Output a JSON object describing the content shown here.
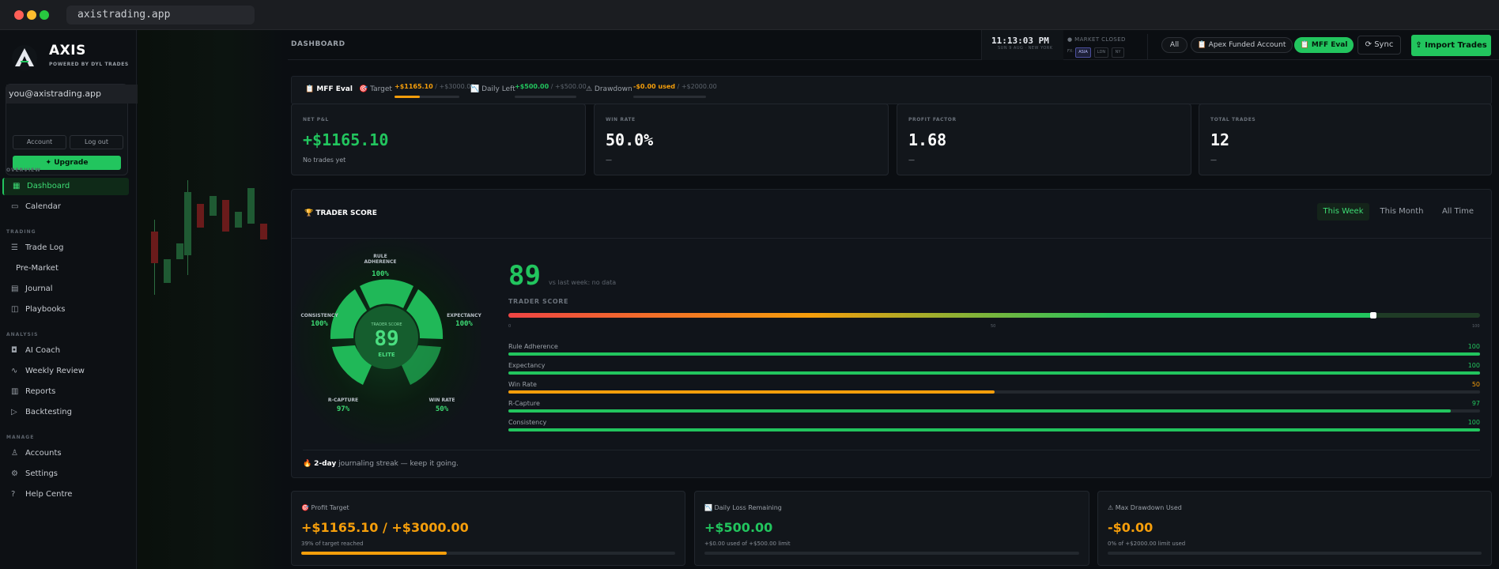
{
  "browser": {
    "url": "axistrading.app"
  },
  "brand": {
    "name": "AXIS",
    "subtitle": "POWERED BY DYL TRADES"
  },
  "account": {
    "email": "you@axistrading.app",
    "account_label": "Account",
    "logout_label": "Log out",
    "upgrade_label": "✦ Upgrade"
  },
  "sidebar": {
    "sections": [
      "OVERVIEW",
      "TRADING",
      "ANALYSIS",
      "MANAGE"
    ],
    "items": [
      {
        "label": "Dashboard"
      },
      {
        "label": "Calendar"
      },
      {
        "label": "Trade Log"
      },
      {
        "label": "Pre-Market"
      },
      {
        "label": "Journal"
      },
      {
        "label": "Playbooks"
      },
      {
        "label": "AI Coach"
      },
      {
        "label": "Weekly Review"
      },
      {
        "label": "Reports"
      },
      {
        "label": "Backtesting"
      },
      {
        "label": "Accounts"
      },
      {
        "label": "Settings"
      },
      {
        "label": "Help Centre"
      }
    ]
  },
  "topbar": {
    "title": "DASHBOARD",
    "clock": "11:13:03 PM",
    "clock_sub": "SUN 9 AUG · NEW YORK",
    "market_status": "● MARKET CLOSED",
    "sessions_label": "FX:",
    "sessions": [
      "ASIA",
      "LDN",
      "NY"
    ],
    "filter_all": "All",
    "account_apex": "📋 Apex Funded Account",
    "account_mff": "📋 MFF Eval",
    "sync_label": "⟳ Sync",
    "import_label": "⇪ Import Trades"
  },
  "evalbar": {
    "name": "📋 MFF Eval",
    "target_label": "🎯 Target",
    "target_value": "+$1165.10",
    "target_max": "/ +$3000.00",
    "target_progress": 0.39,
    "daily_label": "📉 Daily Left",
    "daily_value": "+$500.00",
    "daily_max": "/ +$500.00",
    "daily_progress": 0,
    "drawdown_label": "⚠ Drawdown",
    "drawdown_value": "-$0.00 used",
    "drawdown_max": "/ +$2000.00",
    "drawdown_progress": 0
  },
  "stats": [
    {
      "label": "NET P&L",
      "value": "+$1165.10",
      "sub": "No trades yet",
      "color": "#22c55e"
    },
    {
      "label": "WIN RATE",
      "value": "50.0%",
      "sub": "—",
      "color": "#ffffff"
    },
    {
      "label": "PROFIT FACTOR",
      "value": "1.68",
      "sub": "—",
      "color": "#ffffff"
    },
    {
      "label": "TOTAL TRADES",
      "value": "12",
      "sub": "—",
      "color": "#ffffff"
    }
  ],
  "score": {
    "title": "🏆 TRADER SCORE",
    "tabs": [
      "This Week",
      "This Month",
      "All Time"
    ],
    "value": "89",
    "vs_text": "vs last week: no data",
    "bar_label": "TRADER SCORE",
    "bar_value": 89,
    "ticks": [
      "0",
      "50",
      "100"
    ],
    "center_label": "TRADER SCORE",
    "center_tier": "ELITE",
    "radial": [
      {
        "name": "RULE ADHERENCE",
        "value": "100%"
      },
      {
        "name": "EXPECTANCY",
        "value": "100%"
      },
      {
        "name": "WIN RATE",
        "value": "50%"
      },
      {
        "name": "R-CAPTURE",
        "value": "97%"
      },
      {
        "name": "CONSISTENCY",
        "value": "100%"
      }
    ],
    "metrics": [
      {
        "name": "Rule Adherence",
        "value": 100,
        "label": "100",
        "color": "#22c55e"
      },
      {
        "name": "Expectancy",
        "value": 100,
        "label": "100",
        "color": "#22c55e"
      },
      {
        "name": "Win Rate",
        "value": 50,
        "label": "50",
        "color": "#f59e0b"
      },
      {
        "name": "R-Capture",
        "value": 97,
        "label": "97",
        "color": "#22c55e"
      },
      {
        "name": "Consistency",
        "value": 100,
        "label": "100",
        "color": "#22c55e"
      }
    ],
    "streak_bold": "2-day",
    "streak_text": "journaling streak — keep it going.",
    "streak_icon": "🔥"
  },
  "bottom": [
    {
      "label": "🎯 Profit Target",
      "value": "+$1165.10 / +$3000.00",
      "sub": "39% of target reached",
      "progress": 0.39,
      "color": "#f59e0b"
    },
    {
      "label": "📉 Daily Loss Remaining",
      "value": "+$500.00",
      "sub": "+$0.00 used of +$500.00 limit",
      "progress": 0,
      "color": "#22c55e"
    },
    {
      "label": "⚠ Max Drawdown Used",
      "value": "-$0.00",
      "sub": "0% of +$2000.00 limit used",
      "progress": 0,
      "color": "#f59e0b"
    }
  ]
}
